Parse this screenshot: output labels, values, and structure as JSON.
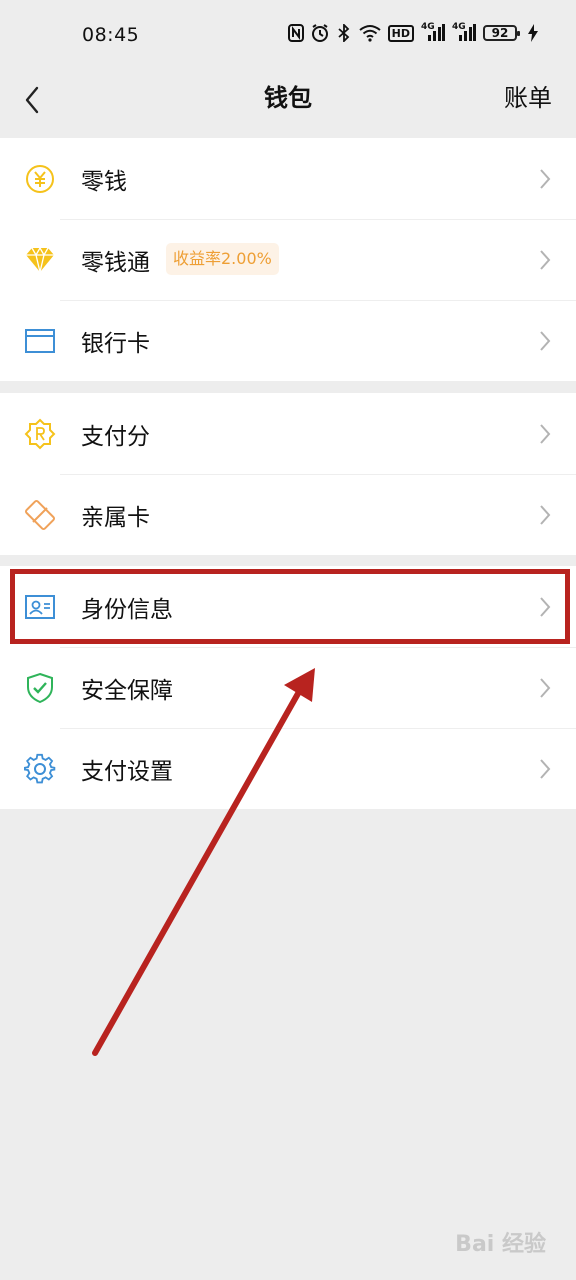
{
  "status_bar": {
    "time": "08:45",
    "battery": "92",
    "icons": [
      "nfc-icon",
      "alarm-icon",
      "bluetooth-icon",
      "wifi-icon",
      "hd-icon",
      "signal-4g-icon",
      "signal-4g-icon",
      "battery-icon",
      "charging-icon"
    ],
    "hd_label": "HD",
    "net1": "4G",
    "net2": "4G"
  },
  "nav": {
    "title": "钱包",
    "right_label": "账单"
  },
  "groups": [
    {
      "items": [
        {
          "label": "零钱",
          "icon": "yuan-coin-icon"
        },
        {
          "label": "零钱通",
          "icon": "diamond-icon",
          "badge": "收益率2.00%"
        },
        {
          "label": "银行卡",
          "icon": "bank-card-icon"
        }
      ]
    },
    {
      "items": [
        {
          "label": "支付分",
          "icon": "pay-score-icon"
        },
        {
          "label": "亲属卡",
          "icon": "family-card-icon"
        }
      ]
    },
    {
      "items": [
        {
          "label": "身份信息",
          "icon": "id-card-icon"
        },
        {
          "label": "安全保障",
          "icon": "shield-check-icon"
        },
        {
          "label": "支付设置",
          "icon": "gear-icon"
        }
      ]
    }
  ],
  "watermark": "Bai 经验",
  "colors": {
    "background": "#ededed",
    "badge_text": "#ee9f35",
    "badge_bg": "#fdf2e6",
    "annotation": "#b8231f",
    "yellow_icon": "#f5c21b",
    "blue_icon": "#3d8fd6",
    "green_icon": "#2fb45a",
    "orange_icon": "#f0a25a"
  }
}
